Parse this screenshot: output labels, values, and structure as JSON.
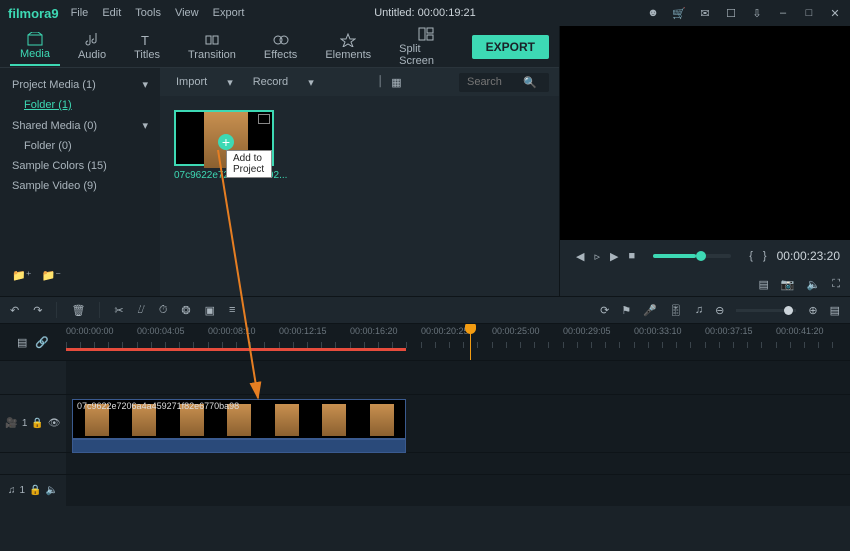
{
  "app": {
    "name": "filmora9",
    "title": "Untitled:  00:00:19:21"
  },
  "menu": [
    "File",
    "Edit",
    "Tools",
    "View",
    "Export"
  ],
  "tabs": [
    {
      "id": "media",
      "label": "Media"
    },
    {
      "id": "audio",
      "label": "Audio"
    },
    {
      "id": "titles",
      "label": "Titles"
    },
    {
      "id": "transition",
      "label": "Transition"
    },
    {
      "id": "effects",
      "label": "Effects"
    },
    {
      "id": "elements",
      "label": "Elements"
    },
    {
      "id": "split",
      "label": "Split Screen"
    }
  ],
  "export_label": "EXPORT",
  "sidebar": {
    "items": [
      {
        "label": "Project Media (1)",
        "expandable": true
      },
      {
        "label": "Folder (1)",
        "sub": true,
        "selected": true
      },
      {
        "label": "Shared Media (0)",
        "expandable": true
      },
      {
        "label": "Folder (0)",
        "sub": true
      },
      {
        "label": "Sample Colors (15)"
      },
      {
        "label": "Sample Video (9)"
      }
    ]
  },
  "content_bar": {
    "import": "Import",
    "record": "Record",
    "search_placeholder": "Search"
  },
  "media": {
    "thumb_label": "07c9622e7206a4a4592...",
    "tooltip": "Add to Project"
  },
  "preview": {
    "time": "00:00:23:20"
  },
  "timeline": {
    "ticks": [
      "00:00:00:00",
      "00:00:04:05",
      "00:00:08:10",
      "00:00:12:15",
      "00:00:16:20",
      "00:00:20:25",
      "00:00:25:00",
      "00:00:29:05",
      "00:00:33:10",
      "00:00:37:15",
      "00:00:41:20"
    ],
    "clip_label": "07c9622e7206a4a459271f82e6770ba98",
    "tracks": {
      "video": "1",
      "audio": "1"
    }
  }
}
